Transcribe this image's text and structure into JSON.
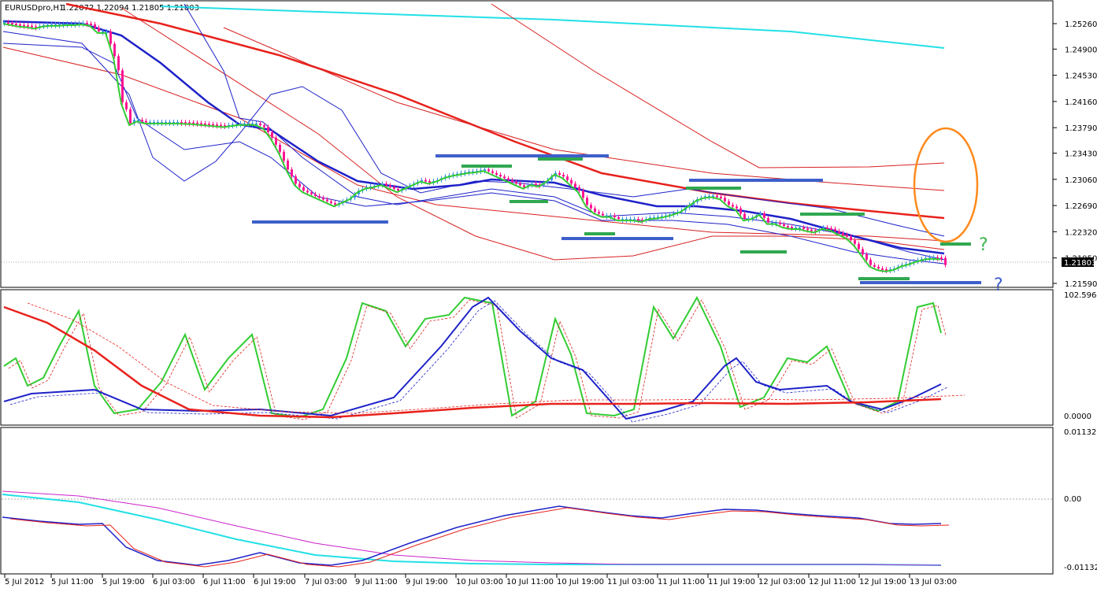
{
  "window": {
    "title": "EURUSDpro,H1",
    "ohlc": "1.22072 1.22094 1.21805 1.21803"
  },
  "chart_data": [
    {
      "type": "candlestick",
      "panel": "main",
      "title": "EURUSDpro,H1",
      "ylim": [
        1.2159,
        1.2545
      ],
      "price_ticks": [
        "1.25260",
        "1.24900",
        "1.24530",
        "1.24160",
        "1.23790",
        "1.23430",
        "1.23060",
        "1.22690",
        "1.22320",
        "1.21950",
        "1.21590"
      ],
      "current_price": "1.21803",
      "x_ticks": [
        "5 Jul 2012",
        "5 Jul 11:00",
        "5 Jul 19:00",
        "6 Jul 03:00",
        "6 Jul 11:00",
        "6 Jul 19:00",
        "7 Jul 03:00",
        "9 Jul 11:00",
        "9 Jul 19:00",
        "10 Jul 03:00",
        "10 Jul 11:00",
        "10 Jul 19:00",
        "11 Jul 03:00",
        "11 Jul 11:00",
        "11 Jul 19:00",
        "12 Jul 03:00",
        "12 Jul 11:00",
        "12 Jul 19:00",
        "13 Jul 03:00"
      ],
      "close_path": [
        [
          0,
          1.2528
        ],
        [
          10,
          1.2526
        ],
        [
          20,
          1.2524
        ],
        [
          30,
          1.2523
        ],
        [
          40,
          1.2521
        ],
        [
          50,
          1.2524
        ],
        [
          60,
          1.2525
        ],
        [
          70,
          1.2525
        ],
        [
          80,
          1.2526
        ],
        [
          90,
          1.2526
        ],
        [
          100,
          1.2527
        ],
        [
          110,
          1.2525
        ],
        [
          120,
          1.2515
        ],
        [
          130,
          1.2515
        ],
        [
          140,
          1.248
        ],
        [
          145,
          1.246
        ],
        [
          150,
          1.2415
        ],
        [
          155,
          1.2405
        ],
        [
          160,
          1.2385
        ],
        [
          165,
          1.239
        ],
        [
          170,
          1.239
        ],
        [
          180,
          1.2387
        ],
        [
          200,
          1.2387
        ],
        [
          220,
          1.2387
        ],
        [
          240,
          1.2386
        ],
        [
          260,
          1.2384
        ],
        [
          280,
          1.2382
        ],
        [
          300,
          1.2385
        ],
        [
          320,
          1.2385
        ],
        [
          330,
          1.238
        ],
        [
          340,
          1.2365
        ],
        [
          350,
          1.2345
        ],
        [
          360,
          1.232
        ],
        [
          370,
          1.23
        ],
        [
          380,
          1.229
        ],
        [
          390,
          1.2285
        ],
        [
          400,
          1.228
        ],
        [
          410,
          1.2275
        ],
        [
          420,
          1.227
        ],
        [
          430,
          1.2275
        ],
        [
          440,
          1.228
        ],
        [
          450,
          1.229
        ],
        [
          460,
          1.2295
        ],
        [
          470,
          1.2297
        ],
        [
          480,
          1.23
        ],
        [
          490,
          1.2295
        ],
        [
          500,
          1.229
        ],
        [
          510,
          1.2295
        ],
        [
          520,
          1.23
        ],
        [
          530,
          1.2305
        ],
        [
          540,
          1.2302
        ],
        [
          550,
          1.2305
        ],
        [
          560,
          1.231
        ],
        [
          570,
          1.2313
        ],
        [
          580,
          1.2315
        ],
        [
          590,
          1.2317
        ],
        [
          600,
          1.2318
        ],
        [
          610,
          1.232
        ],
        [
          620,
          1.2315
        ],
        [
          630,
          1.231
        ],
        [
          640,
          1.2305
        ],
        [
          650,
          1.23
        ],
        [
          660,
          1.2295
        ],
        [
          670,
          1.23
        ],
        [
          680,
          1.2298
        ],
        [
          690,
          1.2305
        ],
        [
          700,
          1.2315
        ],
        [
          710,
          1.231
        ],
        [
          720,
          1.23
        ],
        [
          730,
          1.229
        ],
        [
          740,
          1.227
        ],
        [
          750,
          1.226
        ],
        [
          760,
          1.2255
        ],
        [
          770,
          1.2255
        ],
        [
          780,
          1.225
        ],
        [
          790,
          1.225
        ],
        [
          800,
          1.225
        ],
        [
          810,
          1.2248
        ],
        [
          820,
          1.2252
        ],
        [
          830,
          1.2253
        ],
        [
          840,
          1.2255
        ],
        [
          850,
          1.2258
        ],
        [
          860,
          1.2262
        ],
        [
          870,
          1.227
        ],
        [
          880,
          1.2278
        ],
        [
          890,
          1.2282
        ],
        [
          900,
          1.2283
        ],
        [
          910,
          1.228
        ],
        [
          920,
          1.227
        ],
        [
          930,
          1.2265
        ],
        [
          940,
          1.225
        ],
        [
          950,
          1.2252
        ],
        [
          960,
          1.2258
        ],
        [
          970,
          1.2245
        ],
        [
          980,
          1.2245
        ],
        [
          990,
          1.224
        ],
        [
          1000,
          1.2238
        ],
        [
          1010,
          1.2238
        ],
        [
          1020,
          1.2235
        ],
        [
          1030,
          1.2233
        ],
        [
          1040,
          1.2238
        ],
        [
          1050,
          1.2236
        ],
        [
          1060,
          1.223
        ],
        [
          1070,
          1.2225
        ],
        [
          1080,
          1.2215
        ],
        [
          1090,
          1.22
        ],
        [
          1100,
          1.2185
        ],
        [
          1110,
          1.218
        ],
        [
          1120,
          1.2178
        ],
        [
          1130,
          1.218
        ],
        [
          1140,
          1.2185
        ],
        [
          1150,
          1.2188
        ],
        [
          1160,
          1.2192
        ],
        [
          1170,
          1.2195
        ],
        [
          1180,
          1.2196
        ],
        [
          1190,
          1.2195
        ],
        [
          1195,
          1.2185
        ]
      ],
      "annotations": [
        {
          "shape": "ellipse",
          "color": "#ff8a1c",
          "label": ""
        },
        {
          "shape": "text",
          "text": "?",
          "color": "#3ab54a"
        },
        {
          "shape": "text",
          "text": "?",
          "color": "#3e5fcb"
        }
      ],
      "colors": {
        "bull": "#3c8ee8",
        "bear": "#ff1493",
        "ema_fast": "#33cc33",
        "ema_mid": "#1e22c8",
        "ema_slow": "#e8221c",
        "ema_long": "#22e0e6",
        "bands": "#1e22c8",
        "envelopes": "#d82020",
        "support": "#3e5fcb",
        "swing": "#2fa84f"
      }
    },
    {
      "type": "line",
      "panel": "stochastic",
      "ytick_top": "102.5964",
      "ytick_bottom": "0.0000",
      "series": [
        {
          "color": "#33cc33"
        },
        {
          "color": "#1e22c8"
        },
        {
          "color": "#e8221c"
        }
      ]
    },
    {
      "type": "line",
      "panel": "macd",
      "yticks": [
        "0.01132",
        "0.00",
        "-0.01132"
      ],
      "series": [
        {
          "color": "#22e0e6"
        },
        {
          "color": "#cc22cc"
        },
        {
          "color": "#1e22c8"
        },
        {
          "color": "#e8221c"
        }
      ]
    }
  ]
}
